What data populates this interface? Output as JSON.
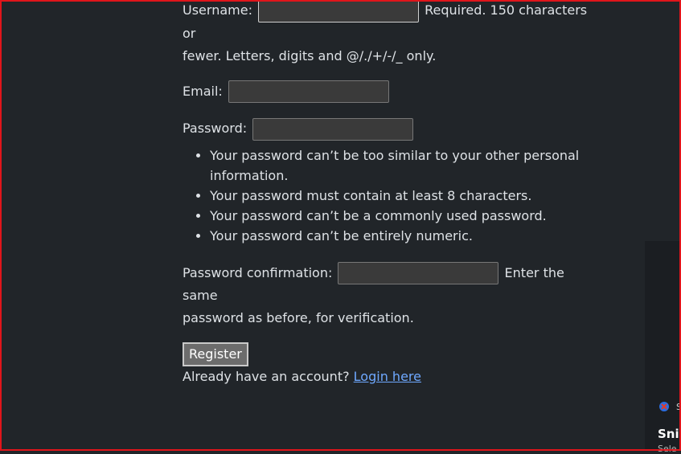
{
  "form": {
    "username_label": "Username:",
    "username_value": "",
    "username_help_1": " Required. 150 characters or",
    "username_help_2": "fewer. Letters, digits and @/./+/-/_ only.",
    "email_label": "Email:",
    "email_value": "",
    "password_label": "Password:",
    "password_value": "",
    "password_rules": [
      "Your password can’t be too similar to your other personal information.",
      "Your password must contain at least 8 characters.",
      "Your password can’t be a commonly used password.",
      "Your password can’t be entirely numeric."
    ],
    "confirm_label": "Password confirmation:",
    "confirm_value": "",
    "confirm_help_1": " Enter the same",
    "confirm_help_2": "password as before, for verification.",
    "register_label": "Register",
    "account_prompt": "Already have an account? ",
    "login_link": "Login here"
  },
  "snip_panel": {
    "small_text": "S",
    "title": "Snip",
    "subtitle": "Sele"
  },
  "colors": {
    "background": "#212529",
    "frame": "#e0151b",
    "link": "#6ea8fe"
  },
  "icons": {
    "snip_app": "snipping-tool-icon"
  }
}
